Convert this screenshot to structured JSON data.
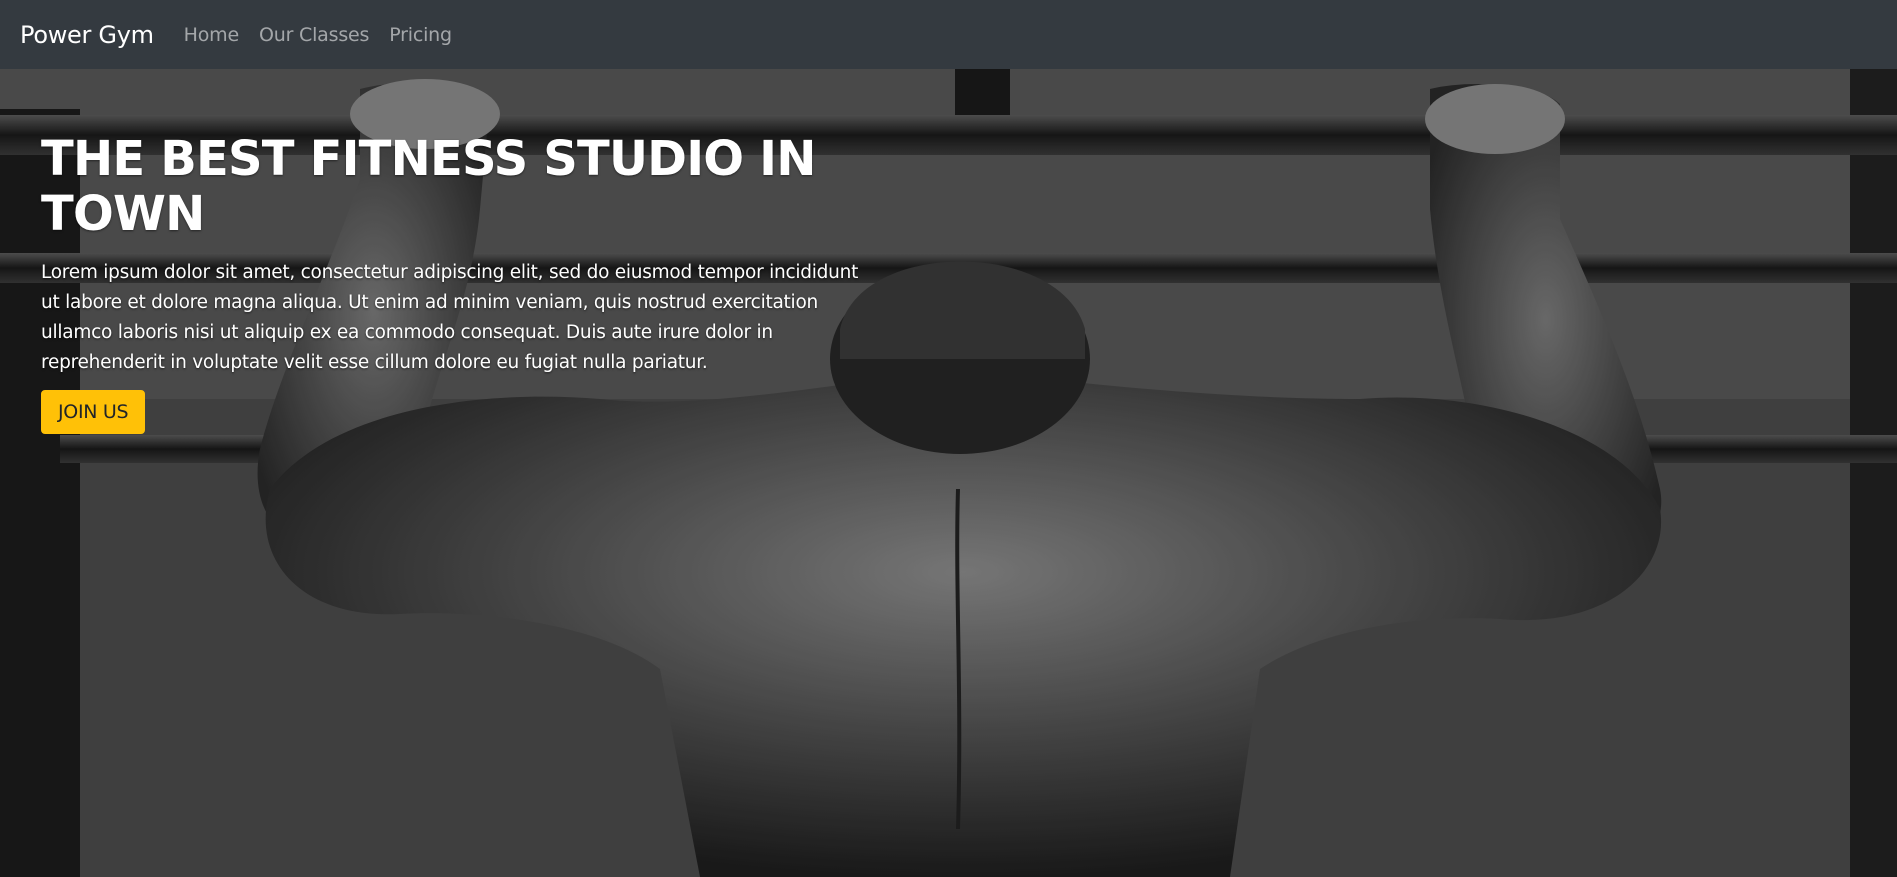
{
  "navbar": {
    "brand": "Power Gym",
    "links": [
      "Home",
      "Our Classes",
      "Pricing"
    ]
  },
  "hero": {
    "title": "THE BEST FITNESS STUDIO IN TOWN",
    "text": "Lorem ipsum dolor sit amet, consectetur adipiscing elit, sed do eiusmod tempor incididunt ut labore et dolore magna aliqua. Ut enim ad minim veniam, quis nostrud exercitation ullamco laboris nisi ut aliquip ex ea commodo consequat. Duis aute irure dolor in reprehenderit in voluptate velit esse cillum dolore eu fugiat nulla pariatur.",
    "button_label": "JOIN US"
  },
  "colors": {
    "navbar_bg": "#343a40",
    "accent": "#ffc107"
  }
}
